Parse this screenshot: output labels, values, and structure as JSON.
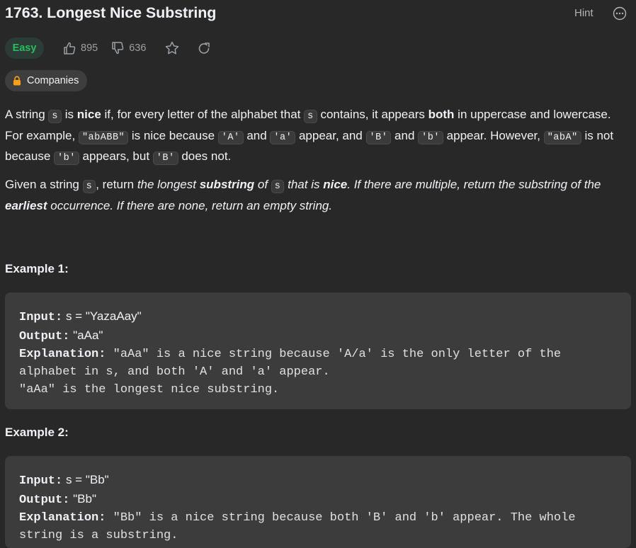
{
  "problem": {
    "title": "1763. Longest Nice Substring",
    "hint_label": "Hint",
    "difficulty": "Easy",
    "likes": "895",
    "dislikes": "636",
    "companies_label": "Companies"
  },
  "description": {
    "p1": [
      {
        "t": "text",
        "v": "A string "
      },
      {
        "t": "code",
        "v": "s"
      },
      {
        "t": "text",
        "v": " is "
      },
      {
        "t": "bold",
        "v": "nice"
      },
      {
        "t": "text",
        "v": " if, for every letter of the alphabet that "
      },
      {
        "t": "code",
        "v": "s"
      },
      {
        "t": "text",
        "v": " contains, it appears "
      },
      {
        "t": "bold",
        "v": "both"
      },
      {
        "t": "text",
        "v": " in uppercase and lowercase. For example, "
      },
      {
        "t": "code",
        "v": "\"abABB\""
      },
      {
        "t": "text",
        "v": " is nice because "
      },
      {
        "t": "code",
        "v": "'A'"
      },
      {
        "t": "text",
        "v": " and "
      },
      {
        "t": "code",
        "v": "'a'"
      },
      {
        "t": "text",
        "v": " appear, and "
      },
      {
        "t": "code",
        "v": "'B'"
      },
      {
        "t": "text",
        "v": " and "
      },
      {
        "t": "code",
        "v": "'b'"
      },
      {
        "t": "text",
        "v": " appear. However, "
      },
      {
        "t": "code",
        "v": "\"abA\""
      },
      {
        "t": "text",
        "v": " is not because "
      },
      {
        "t": "code",
        "v": "'b'"
      },
      {
        "t": "text",
        "v": " appears, but "
      },
      {
        "t": "code",
        "v": "'B'"
      },
      {
        "t": "text",
        "v": " does not."
      }
    ],
    "p2": [
      {
        "t": "text",
        "v": "Given a string "
      },
      {
        "t": "code",
        "v": "s"
      },
      {
        "t": "text",
        "v": ", return "
      },
      {
        "t": "italic",
        "v": "the longest "
      },
      {
        "t": "bolditalic",
        "v": "substring"
      },
      {
        "t": "italic",
        "v": " of "
      },
      {
        "t": "code",
        "v": "s"
      },
      {
        "t": "italic",
        "v": " that is "
      },
      {
        "t": "bolditalic",
        "v": "nice"
      },
      {
        "t": "italic",
        "v": ". If there are multiple, return the substring of the "
      },
      {
        "t": "bolditalic",
        "v": "earliest"
      },
      {
        "t": "italic",
        "v": " occurrence. If there are none, return an empty string."
      }
    ]
  },
  "examples": [
    {
      "title": "Example 1:",
      "input_label": "Input:",
      "input_value": " s = \"YazaAay\"",
      "output_label": "Output:",
      "output_value": " \"aAa\"",
      "explanation_label": "Explanation:",
      "explanation_lines": [
        " \"aAa\" is a nice string because 'A/a' is the only letter of the alphabet in s, and both 'A' and 'a' appear.",
        "\"aAa\" is the longest nice substring."
      ]
    },
    {
      "title": "Example 2:",
      "input_label": "Input:",
      "input_value": " s = \"Bb\"",
      "output_label": "Output:",
      "output_value": " \"Bb\"",
      "explanation_label": "Explanation:",
      "explanation_lines": [
        " \"Bb\" is a nice string because both 'B' and 'b' appear. The whole string is a substring."
      ]
    }
  ],
  "colors": {
    "background": "#282828",
    "easy": "#2cbb5d",
    "lock": "#ffa116"
  },
  "icons": [
    "thumbs-up-icon",
    "thumbs-down-icon",
    "star-icon",
    "share-icon",
    "lock-icon",
    "more-icon"
  ]
}
